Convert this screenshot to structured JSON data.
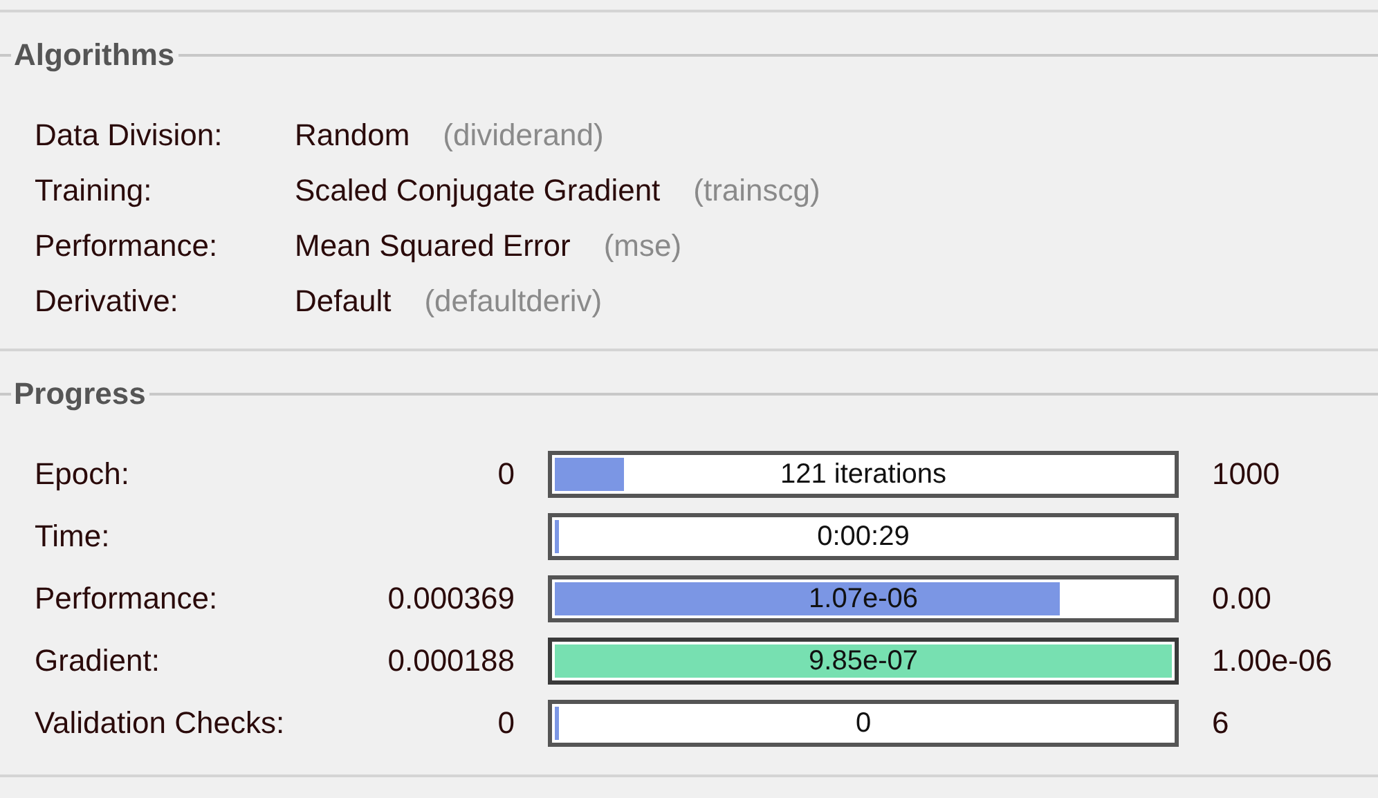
{
  "algorithms": {
    "title": "Algorithms",
    "rows": [
      {
        "label": "Data Division:",
        "value": "Random",
        "function": "(dividerand)"
      },
      {
        "label": "Training:",
        "value": "Scaled Conjugate Gradient",
        "function": "(trainscg)"
      },
      {
        "label": "Performance:",
        "value": "Mean Squared Error",
        "function": "(mse)"
      },
      {
        "label": "Derivative:",
        "value": "Default",
        "function": "(defaultderiv)"
      }
    ]
  },
  "progress": {
    "title": "Progress",
    "rows": [
      {
        "label": "Epoch:",
        "min": "0",
        "reading": "121 iterations",
        "level": 0.12,
        "goal_met": false,
        "max": "1000"
      },
      {
        "label": "Time:",
        "reading": "0:00:29",
        "level": 0,
        "goal_met": false
      },
      {
        "label": "Performance:",
        "min": "0.000369",
        "reading": "1.07e-06",
        "level": 0.82,
        "goal_met": false,
        "max": "0.00"
      },
      {
        "label": "Gradient:",
        "min": "0.000188",
        "reading": "9.85e-07",
        "level": 1,
        "goal_met": true,
        "max": "1.00e-06"
      },
      {
        "label": "Validation Checks:",
        "min": "0",
        "reading": "0",
        "level": 0,
        "goal_met": false,
        "max": "6"
      }
    ]
  }
}
